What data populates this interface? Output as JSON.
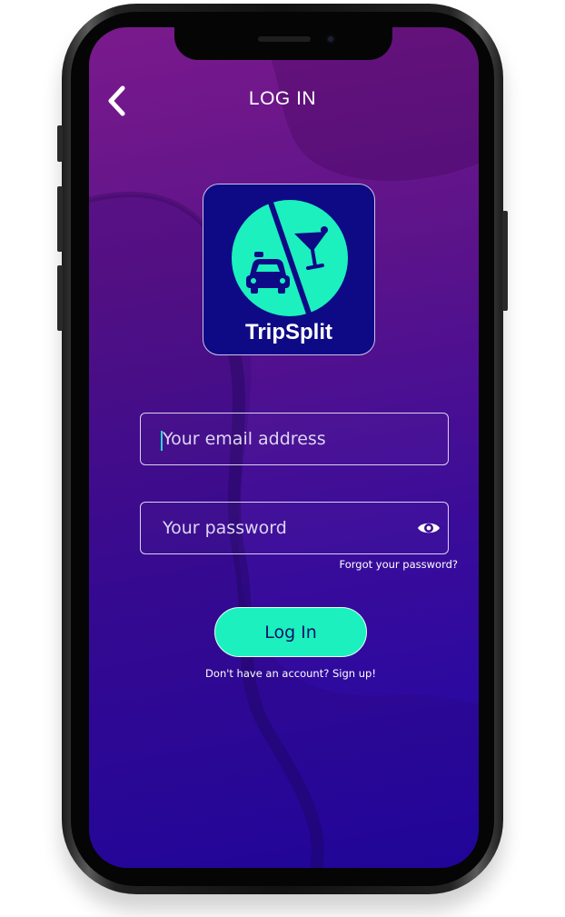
{
  "header": {
    "title": "LOG IN",
    "back_icon": "chevron-left-icon"
  },
  "logo": {
    "app_name": "TripSplit",
    "icons": [
      "taxi-icon",
      "cocktail-glass-icon"
    ],
    "badge_color": "#1cf0be",
    "tile_color": "#0e0a86"
  },
  "form": {
    "email": {
      "value": "",
      "placeholder": "Your email address"
    },
    "password": {
      "value": "",
      "placeholder": "Your password",
      "toggle_icon": "eye-icon"
    },
    "forgot_label": "Forgot your password?",
    "submit_label": "Log In",
    "signup_label": "Don't have an account? Sign up!"
  },
  "colors": {
    "accent": "#1cf0be",
    "background_top": "#7a1a8c",
    "background_bottom": "#1e06a6"
  }
}
